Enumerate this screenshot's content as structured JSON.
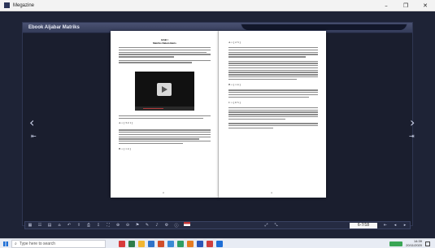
{
  "window": {
    "title": "Megazine",
    "controls": [
      "–",
      "❐",
      "✕"
    ]
  },
  "book": {
    "title": "Ebook Aljabar Matriks",
    "left_page": {
      "heading_1": "BAB I",
      "heading_2": "Matriks Dalam Baris",
      "page_number": "3",
      "matrix_top": "A = [ 3  2  1 ]",
      "matrix_bottom": "B = [ 1  4 ]"
    },
    "right_page": {
      "matrix_1": "A = [ 2  3 ]",
      "matrix_2": "B = [ 1  4 ]",
      "matrix_3": "C = [ 0  5 ]",
      "page_number": "4"
    }
  },
  "navigation": {
    "prev_arrow": "‹",
    "next_arrow": "›",
    "first_page": "⇤",
    "last_page": "⇥"
  },
  "toolbar": {
    "page_value": "6-7/18",
    "icons": [
      "grid-icon",
      "thumbnails-icon",
      "table-icon",
      "home-icon",
      "back-icon",
      "share-icon",
      "print-icon",
      "download-icon",
      "fullscreen-icon",
      "zoom-in-icon",
      "zoom-out-icon",
      "bookmark-icon",
      "note-icon",
      "sound-icon",
      "settings-icon",
      "info-icon",
      "flag-icon",
      "expand-icon",
      "resize-icon",
      "first-icon",
      "prev-icon",
      "next-icon"
    ]
  },
  "taskbar": {
    "search_placeholder": "Type here to search",
    "time": "14:39",
    "date": "20/11/2020",
    "app_colors": [
      "#d83b3b",
      "#2d7d4a",
      "#f2b632",
      "#2f73c9",
      "#d04e2a",
      "#3a8ad6",
      "#2f9e64",
      "#e57c22",
      "#2b56b8",
      "#cf3e3e",
      "#1f6fd6"
    ]
  }
}
